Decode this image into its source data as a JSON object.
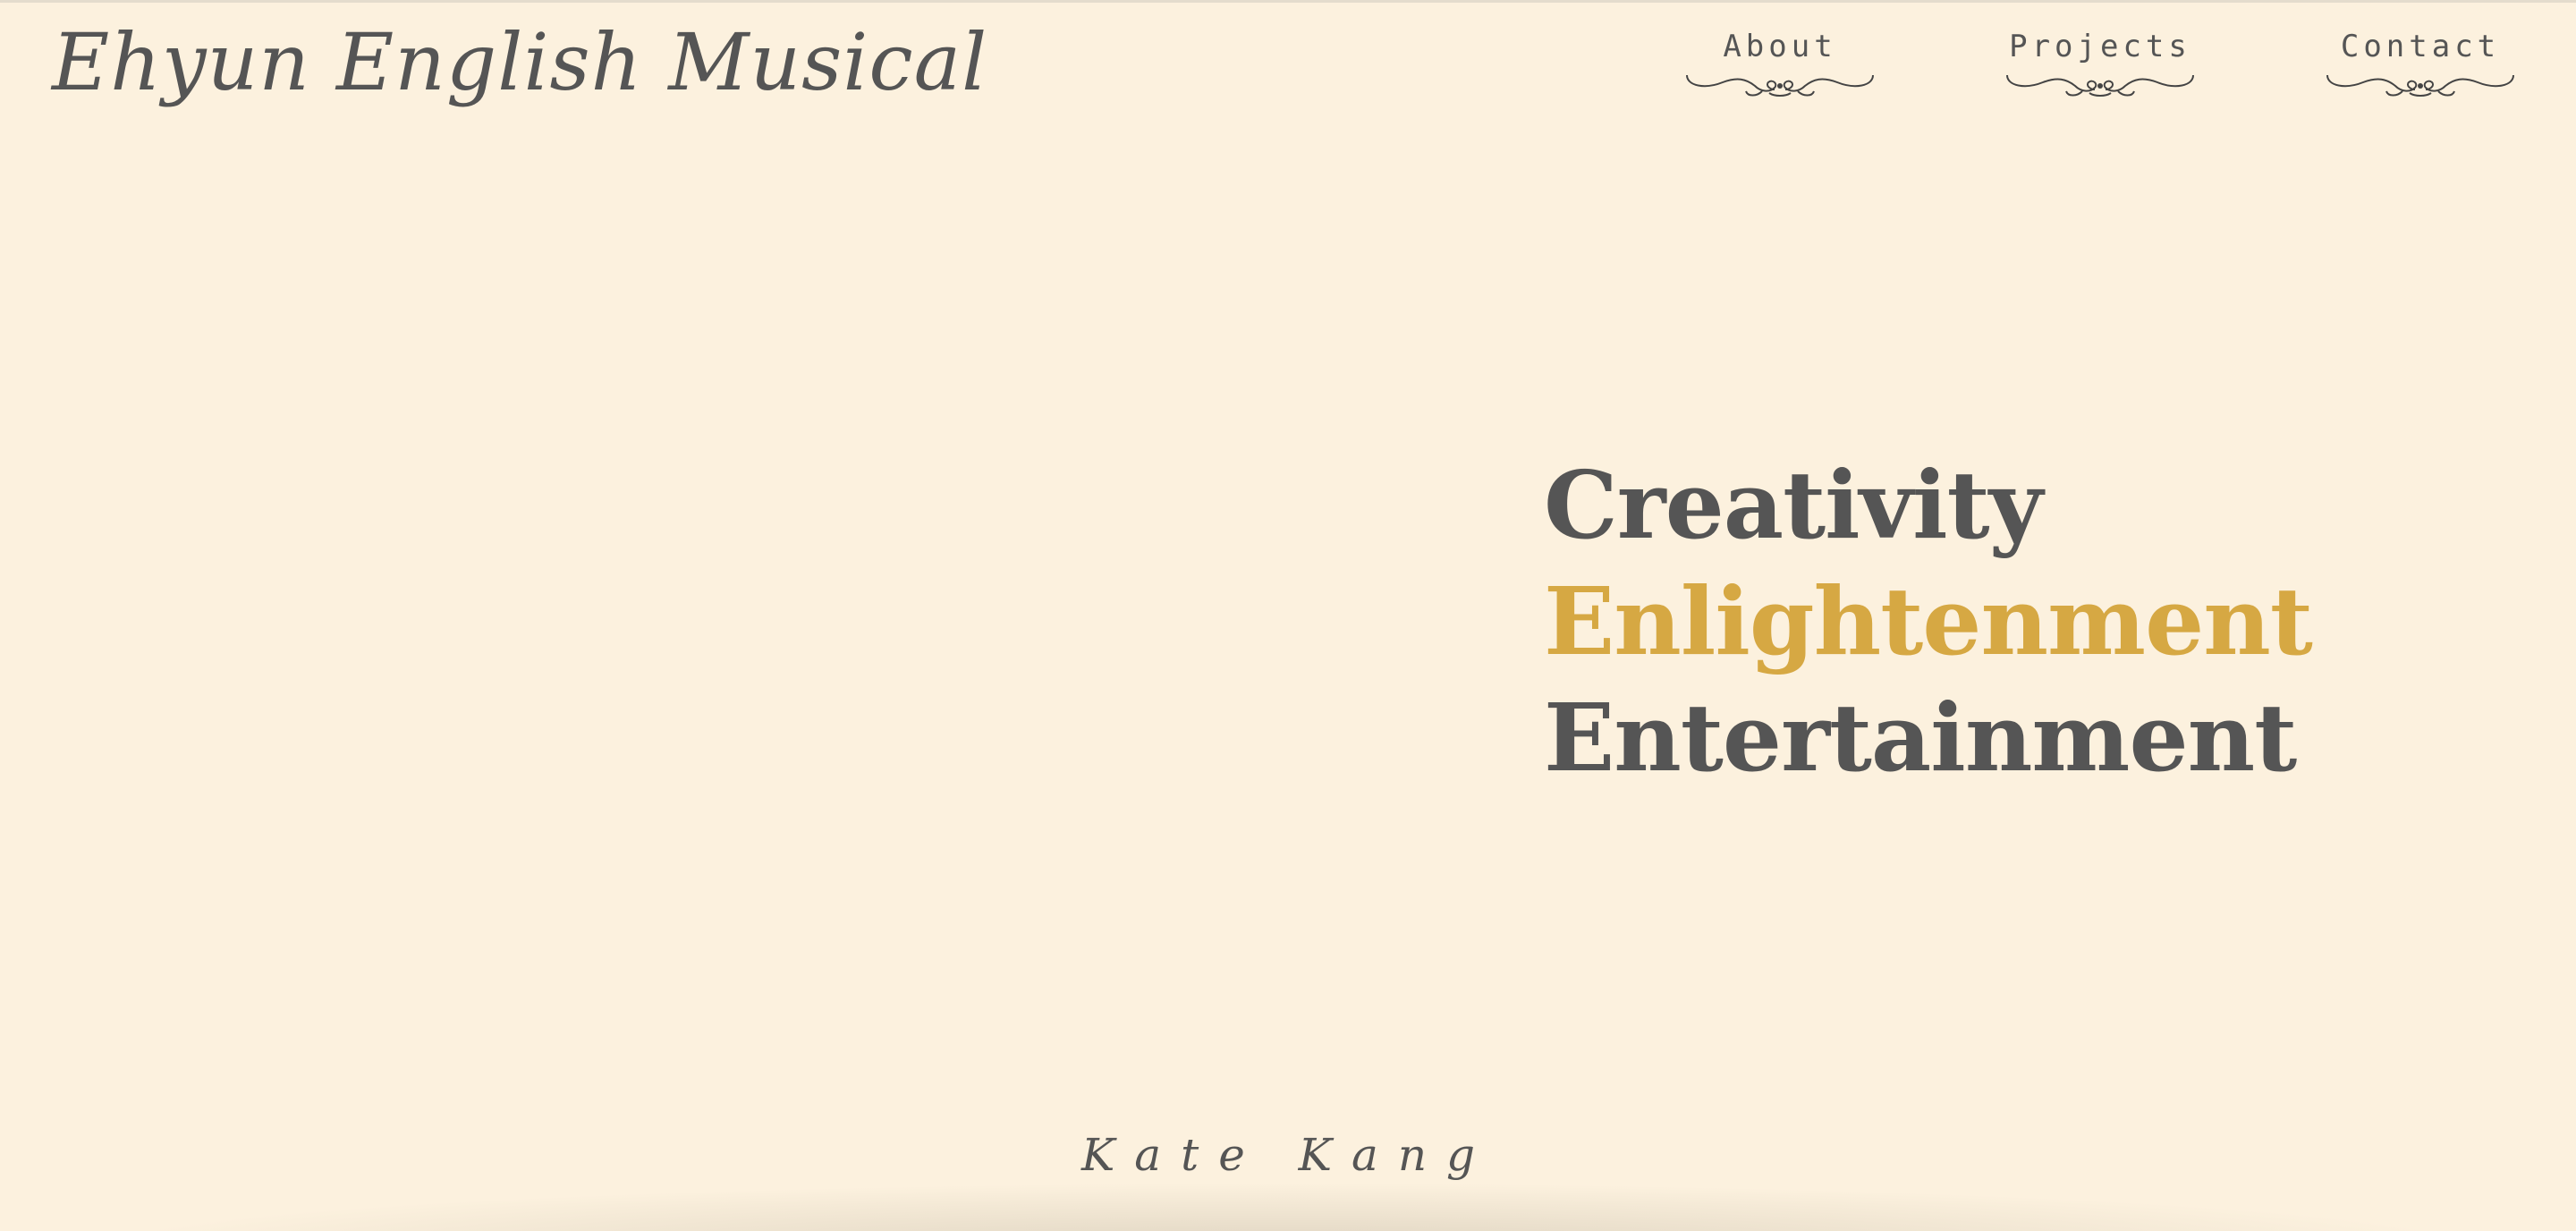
{
  "header": {
    "site_title": "Ehyun English Musical"
  },
  "nav": {
    "items": [
      {
        "label": "About",
        "icon": "flourish-ornament-icon"
      },
      {
        "label": "Projects",
        "icon": "flourish-ornament-icon"
      },
      {
        "label": "Contact",
        "icon": "flourish-ornament-icon"
      }
    ]
  },
  "hero": {
    "words": [
      "Creativity",
      "Enlightenment",
      "Entertainment"
    ]
  },
  "footer": {
    "signature": "Kate Kang"
  },
  "colors": {
    "background": "#fcf1de",
    "text": "#555555",
    "accent": "#d6a843"
  }
}
